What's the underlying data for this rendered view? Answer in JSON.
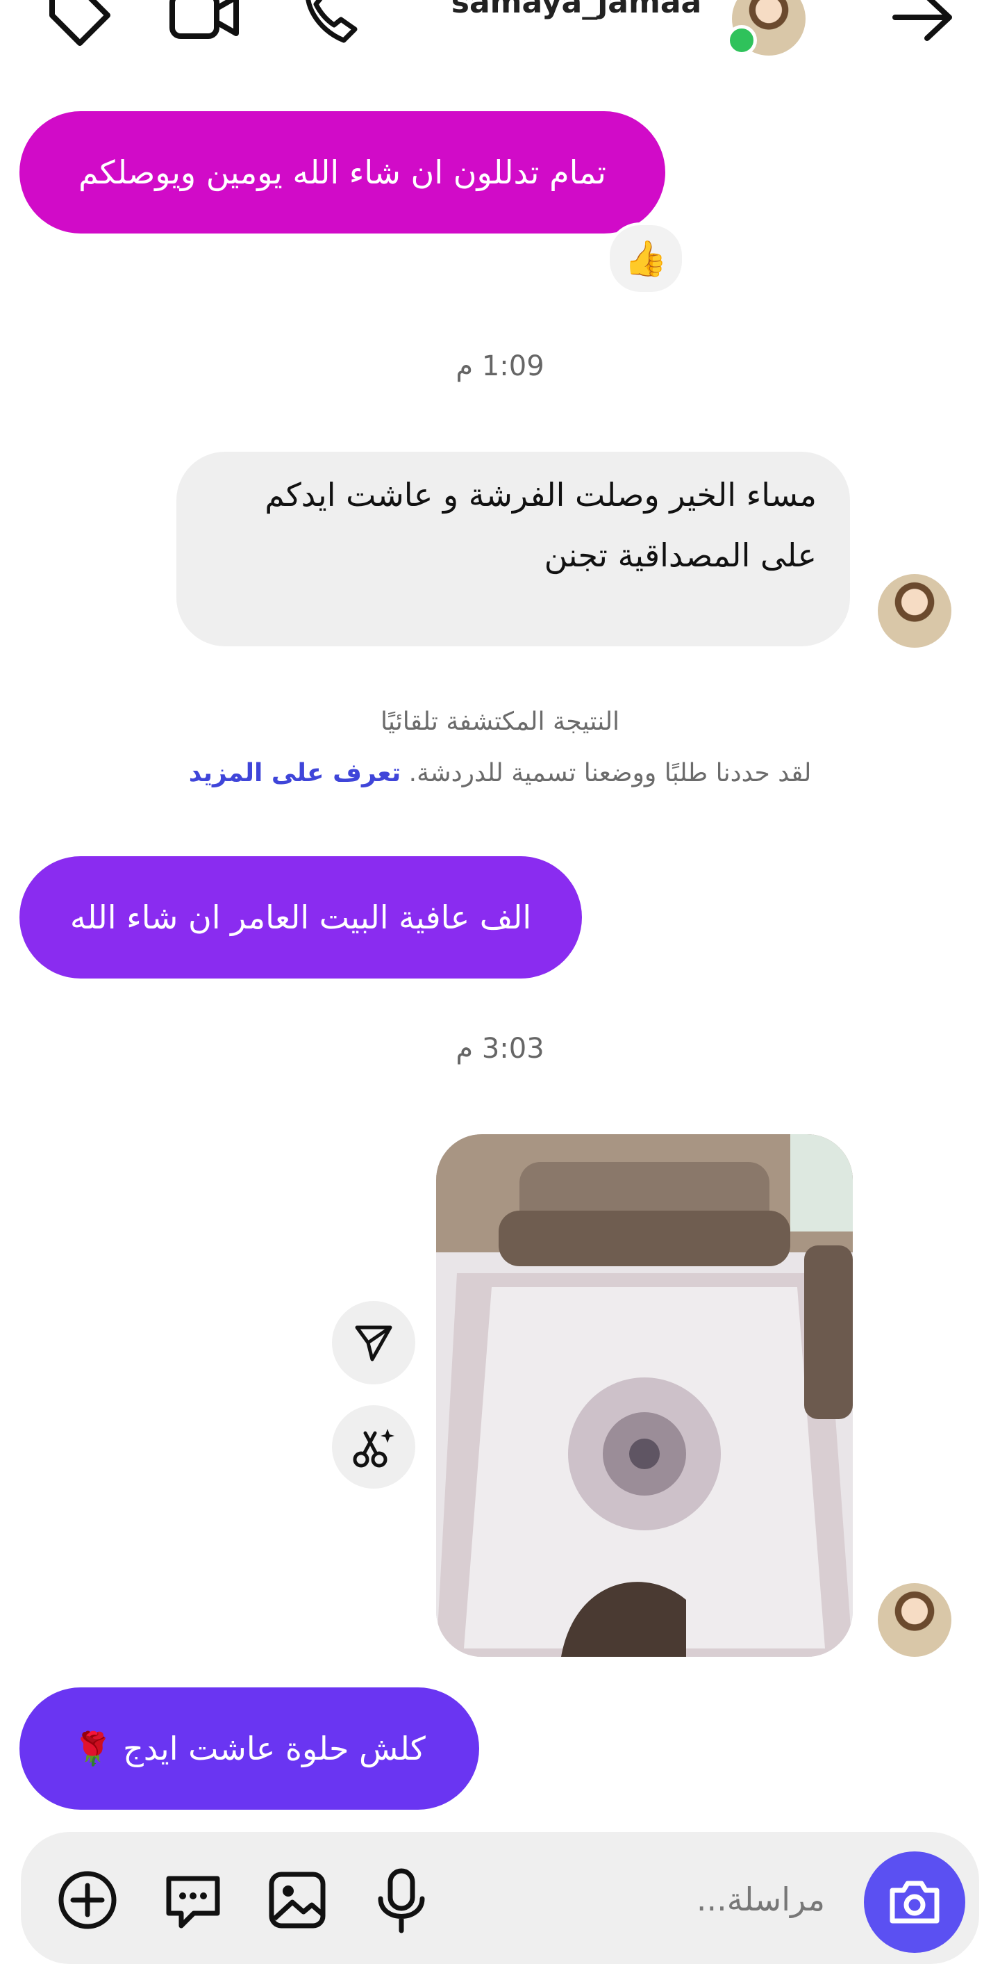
{
  "header": {
    "username": "samaya_jamaa",
    "icons": [
      "tag-icon",
      "video-call-icon",
      "phone-icon",
      "back-arrow-icon"
    ],
    "online": true
  },
  "messages": [
    {
      "type": "outgoing",
      "text": "تمام تدللون ان شاء الله يومين ويوصلكم",
      "reaction": "👍"
    },
    {
      "type": "timestamp",
      "text": "1:09 م"
    },
    {
      "type": "incoming",
      "lines": [
        "مساء الخير وصلت الفرشة و عاشت ايدكم",
        "على المصداقية تجنن"
      ]
    },
    {
      "type": "notice",
      "title": "النتيجة المكتشفة تلقائيًا",
      "body": "لقد حددنا طلبًا ووضعنا تسمية للدردشة.",
      "link": "تعرف على المزيد"
    },
    {
      "type": "outgoing",
      "text": "الف عافية البيت العامر ان شاء الله"
    },
    {
      "type": "timestamp",
      "text": "3:03 م"
    },
    {
      "type": "incoming-photo"
    },
    {
      "type": "outgoing",
      "text": "كلش حلوة عاشت ايدج 🌹"
    }
  ],
  "composer": {
    "placeholder": "مراسلة...",
    "icons": [
      "camera-icon",
      "microphone-icon",
      "gallery-icon",
      "sticker-icon",
      "add-icon"
    ]
  },
  "colors": {
    "bubble_1": "#d10bc8",
    "bubble_2": "#8a2cf0",
    "bubble_3": "#6a35f2",
    "incoming_bg": "#efefef",
    "link": "#3f45d9",
    "camera_btn": "#5b50f2"
  }
}
